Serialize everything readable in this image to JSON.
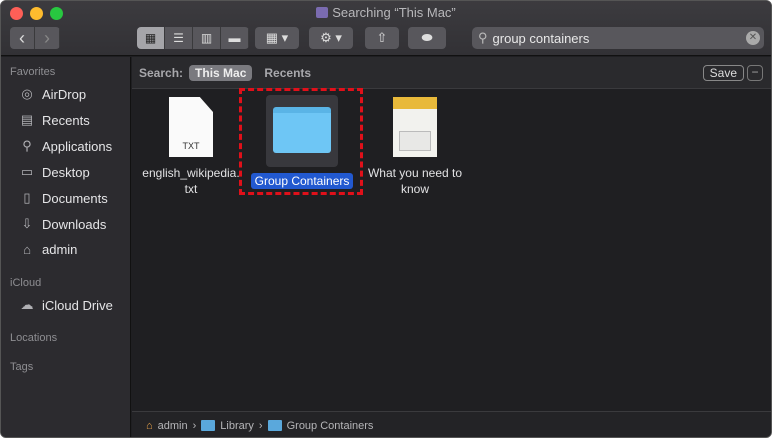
{
  "window": {
    "title": "Searching “This Mac”"
  },
  "toolbar": {
    "back": "‹",
    "forward": "›",
    "search_value": "group containers"
  },
  "sidebar": {
    "favorites_header": "Favorites",
    "favorites": [
      {
        "label": "AirDrop",
        "icon": "◎"
      },
      {
        "label": "Recents",
        "icon": "▤"
      },
      {
        "label": "Applications",
        "icon": "⚲"
      },
      {
        "label": "Desktop",
        "icon": "▭"
      },
      {
        "label": "Documents",
        "icon": "▯"
      },
      {
        "label": "Downloads",
        "icon": "⇩"
      },
      {
        "label": "admin",
        "icon": "⌂"
      }
    ],
    "icloud_header": "iCloud",
    "icloud": [
      {
        "label": "iCloud Drive",
        "icon": "☁"
      }
    ],
    "locations_header": "Locations",
    "tags_header": "Tags"
  },
  "scope": {
    "label": "Search:",
    "this_mac": "This Mac",
    "recents": "Recents",
    "save": "Save",
    "minus": "−"
  },
  "files": [
    {
      "name": "english_wikipedia.",
      "name2": "txt",
      "badge": "TXT"
    },
    {
      "name": "Group Containers"
    },
    {
      "name": "What you need to",
      "name2": "know"
    }
  ],
  "pathbar": [
    "admin",
    "Library",
    "Group Containers"
  ],
  "colors": {
    "selection": "#2259d0",
    "highlight_box": "#e0101a"
  }
}
